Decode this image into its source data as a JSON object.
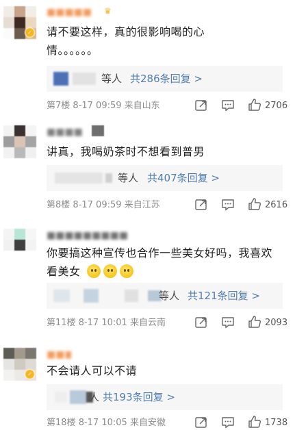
{
  "comments": [
    {
      "text_lines": [
        "请不要这样，真的很影响喝的心",
        "情。。。。。。"
      ],
      "reply_who": "等人",
      "reply_count": "共286条回复 >",
      "floor": "第7楼",
      "date": "8-17 09:59",
      "location": "来自山东",
      "likes": "2706"
    },
    {
      "text_lines": [
        "讲真，我喝奶茶时不想看到普男"
      ],
      "reply_who": "等人",
      "reply_count": "共407条回复 >",
      "floor": "第8楼",
      "date": "8-17 09:59",
      "location": "来自江苏",
      "likes": "2616"
    },
    {
      "text_lines": [
        "你要搞这种宣传也合作一些美女好吗，我喜欢",
        "看美女"
      ],
      "reply_who": "等人",
      "reply_count": "共121条回复 >",
      "floor": "第11楼",
      "date": "8-17 10:01",
      "location": "来自云南",
      "likes": "2093"
    },
    {
      "text_lines": [
        "不会请人可以不请"
      ],
      "reply_who": "人",
      "reply_count": "共193条回复 >",
      "floor": "第18楼",
      "date": "8-17 10:05",
      "location": "来自安徽",
      "likes": "1738"
    }
  ],
  "icons": {
    "share": "share-icon",
    "comment": "comment-icon",
    "like": "thumbs-up-icon",
    "verified": "verified-badge-icon",
    "emoji": "smile-emoji-icon"
  },
  "colors": {
    "link_blue": "#507daf",
    "reply_bg": "#f6f6f6",
    "meta_gray": "#8c8c8c"
  }
}
